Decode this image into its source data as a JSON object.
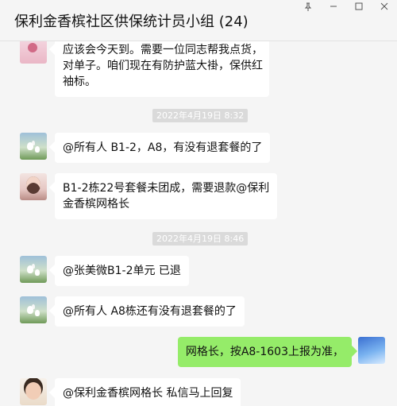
{
  "window": {
    "title": "保利金香槟社区供保统计员小组 (24)",
    "controls": [
      "pin-icon",
      "minimize-icon",
      "maximize-icon",
      "close-icon"
    ]
  },
  "messages": [
    {
      "type": "text",
      "from": "other",
      "avatar": "pink-avatar",
      "lines": [
        "应该会今天到。需要一位同志帮我点货，",
        "对单子。咱们现在有防护蓝大褂，保供红",
        "袖标。"
      ]
    },
    {
      "type": "time",
      "text": "2022年4月19日 8:32"
    },
    {
      "type": "text",
      "from": "other",
      "avatar": "flower-avatar",
      "lines": [
        "@所有人  B1-2，A8，有没有退套餐的了"
      ]
    },
    {
      "type": "text",
      "from": "other",
      "avatar": "girl-avatar",
      "lines": [
        "B1-2栋22号套餐未团成，需要退款@保利",
        "金香槟网格长"
      ]
    },
    {
      "type": "time",
      "text": "2022年4月19日 8:46"
    },
    {
      "type": "text",
      "from": "other",
      "avatar": "flower-avatar",
      "lines": [
        "@张美微B1-2单元 已退"
      ]
    },
    {
      "type": "text",
      "from": "other",
      "avatar": "flower-avatar",
      "lines": [
        "@所有人  A8栋还有没有退套餐的了"
      ]
    },
    {
      "type": "text",
      "from": "self",
      "avatar": "sky-avatar",
      "lines": [
        "网格长，按A8-1603上报为准，"
      ]
    },
    {
      "type": "text",
      "from": "other",
      "avatar": "kid-avatar",
      "lines": [
        "@保利金香槟网格长 私信马上回复"
      ]
    }
  ],
  "colors": {
    "background": "#f5f5f5",
    "bubble_other": "#ffffff",
    "bubble_self": "#95ec69",
    "timestamp_bg": "#dadada"
  }
}
